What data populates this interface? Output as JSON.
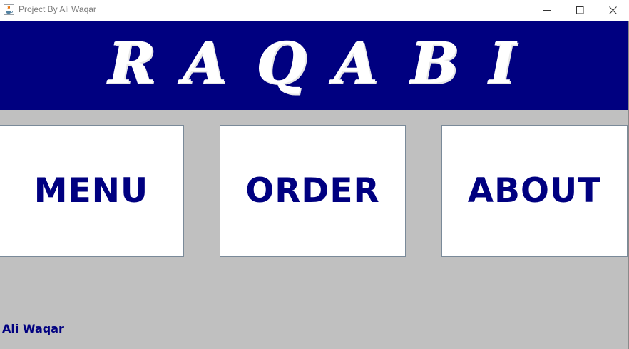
{
  "window": {
    "title": "Project By Ali Waqar",
    "icon": "java-cup-icon",
    "controls": [
      "minimize-icon",
      "maximize-icon",
      "close-icon"
    ]
  },
  "banner": {
    "letters": [
      "R",
      "A",
      "Q",
      "A",
      "B",
      "I"
    ],
    "background": "#000080",
    "text_color": "#ffffff"
  },
  "buttons": {
    "menu": "MENU",
    "order": "ORDER",
    "about": "ABOUT"
  },
  "footer": {
    "author": "Ali Waqar"
  },
  "colors": {
    "accent": "#000080",
    "panel_bg": "#c0c0c0",
    "button_bg": "#ffffff"
  }
}
